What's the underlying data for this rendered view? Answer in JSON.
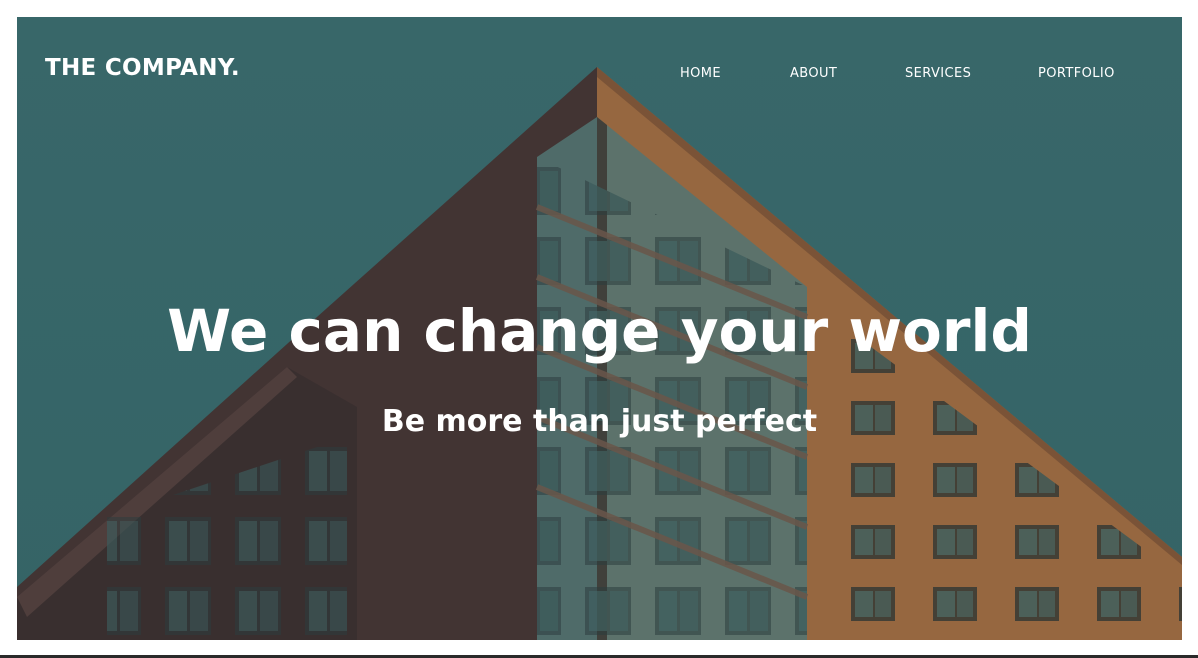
{
  "brand": {
    "name": "THE COMPANY."
  },
  "nav": {
    "items": [
      {
        "label": "HOME"
      },
      {
        "label": "ABOUT"
      },
      {
        "label": "SERVICES"
      },
      {
        "label": "PORTFOLIO"
      }
    ]
  },
  "hero": {
    "title": "We can change your world",
    "subtitle": "Be more than just perfect"
  },
  "colors": {
    "sky": "#3f6f72",
    "brick_light": "#b8713f",
    "brick_dark": "#4f3330",
    "text": "#ffffff"
  }
}
